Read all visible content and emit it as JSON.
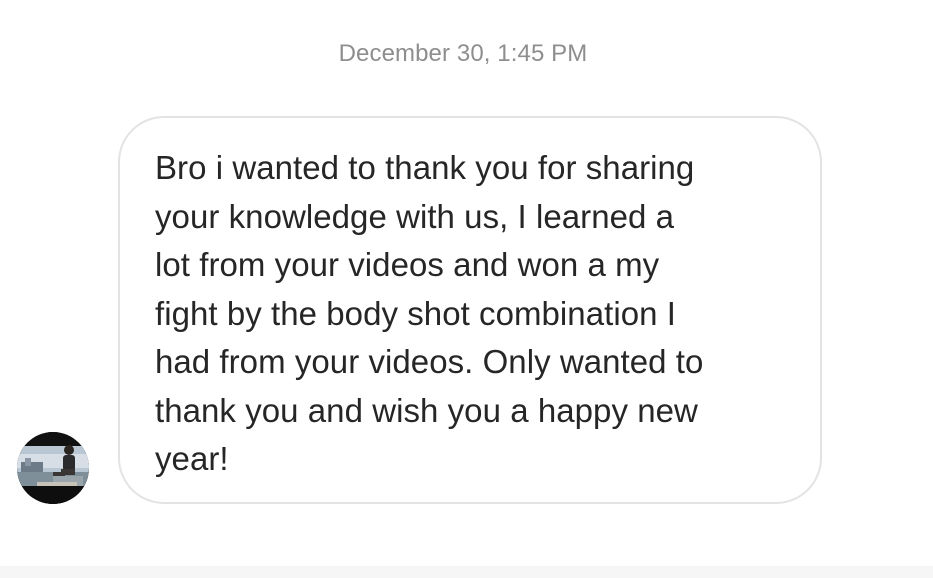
{
  "thread": {
    "timestamp": "December 30, 1:45 PM"
  },
  "message": {
    "text": "Bro i wanted to thank you for sharing\nyour knowledge with us, I learned a\nlot from your videos and won a my\nfight by the body shot combination I\nhad from your videos. Only wanted to\nthank you and wish you a happy new\nyear!",
    "sender_avatar_icon": "profile-photo"
  },
  "colors": {
    "timestamp": "#8e8e8e",
    "bubble_border": "#e3e3e3",
    "message_text": "#262626",
    "background": "#ffffff"
  }
}
